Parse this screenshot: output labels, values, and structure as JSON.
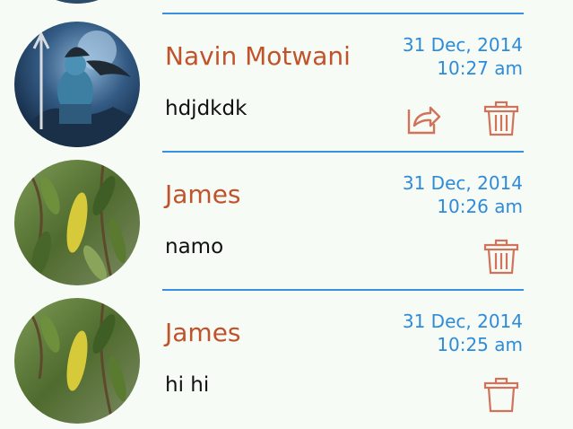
{
  "messages": [
    {
      "name": "",
      "text": "",
      "date": "",
      "time": ""
    },
    {
      "name": "Navin Motwani",
      "text": "hdjdkdk",
      "date": "31 Dec, 2014",
      "time": "10:27 am",
      "has_share": true,
      "has_delete": true,
      "avatar": "shiva-avatar"
    },
    {
      "name": "James",
      "text": "namo",
      "date": "31 Dec, 2014",
      "time": "10:26 am",
      "has_share": false,
      "has_delete": true,
      "avatar": "leaves-avatar"
    },
    {
      "name": "James",
      "text": "hi hi",
      "date": "31 Dec, 2014",
      "time": "10:25 am",
      "has_share": false,
      "has_delete": true,
      "avatar": "leaves-avatar"
    }
  ],
  "colors": {
    "name": "#c0532b",
    "timestamp": "#2f8bd8",
    "separator": "#3b8fe0",
    "icon": "#d0735a",
    "background": "#f6fbf5"
  },
  "icons": {
    "share": "share-icon",
    "delete": "trash-icon"
  }
}
